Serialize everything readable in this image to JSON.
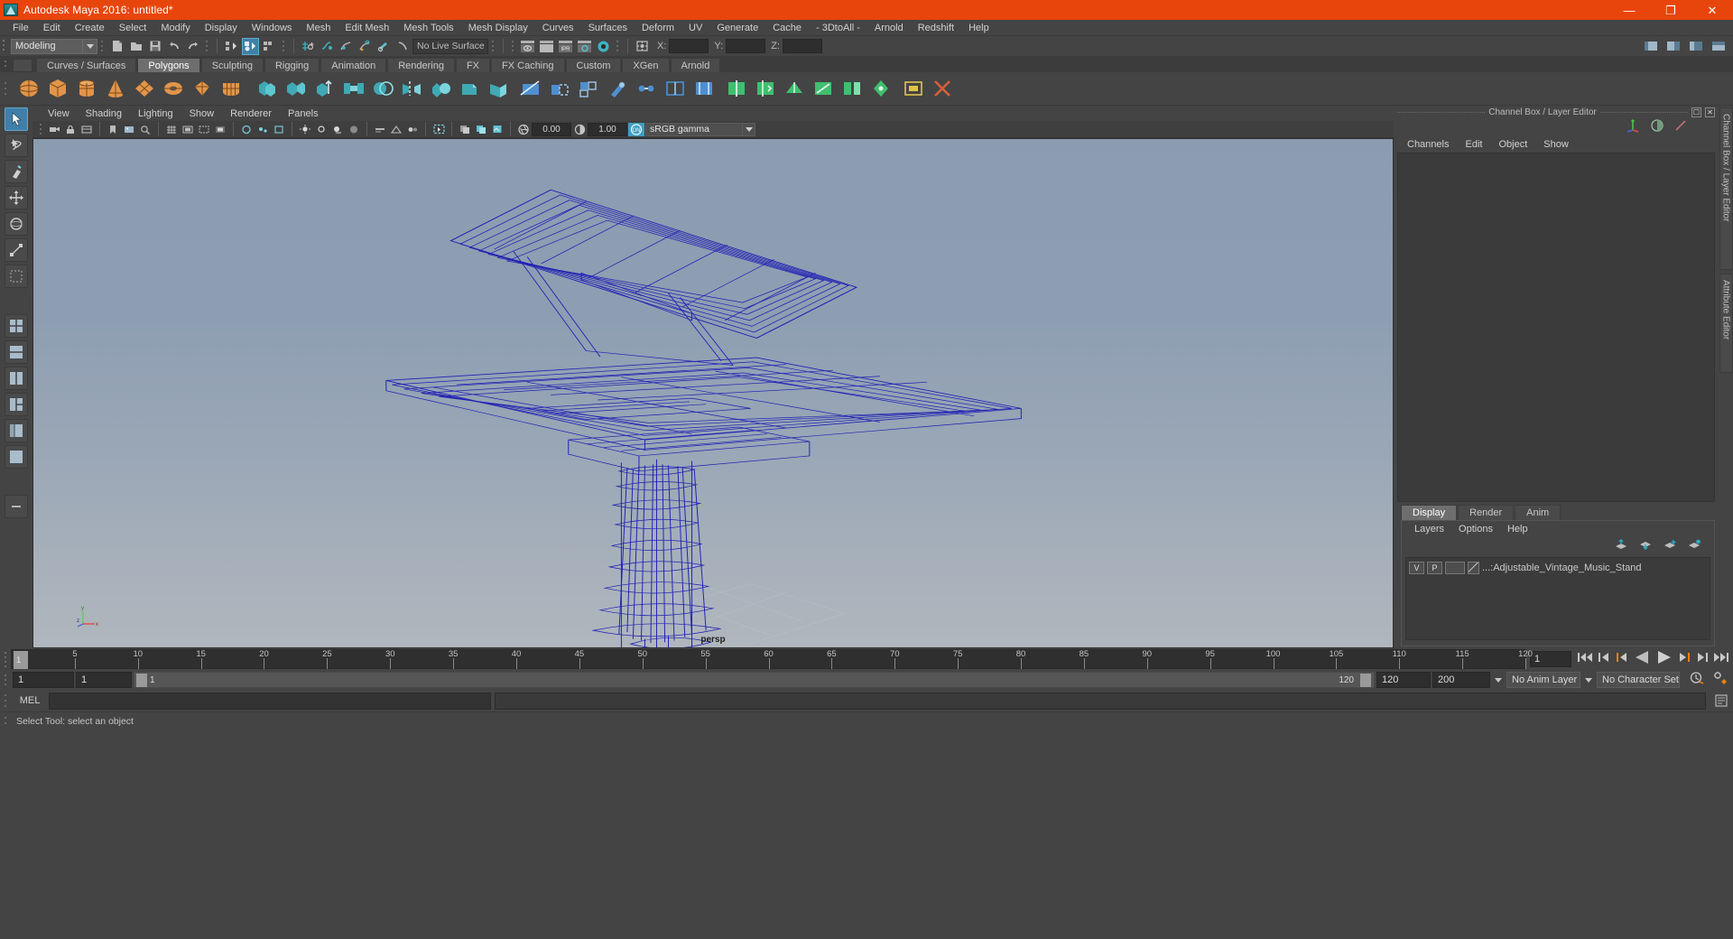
{
  "window": {
    "title": "Autodesk Maya 2016: untitled*",
    "app_icon": "maya-logo-icon",
    "buttons": [
      {
        "name": "minimize-button",
        "glyph": "—"
      },
      {
        "name": "maximize-button",
        "glyph": "❐"
      },
      {
        "name": "close-button",
        "glyph": "✕"
      }
    ],
    "accent_color": "#e8450c",
    "chrome_color": "#444444"
  },
  "menubar": {
    "items": [
      "File",
      "Edit",
      "Create",
      "Select",
      "Modify",
      "Display",
      "Windows",
      "Mesh",
      "Edit Mesh",
      "Mesh Tools",
      "Mesh Display",
      "Curves",
      "Surfaces",
      "Deform",
      "UV",
      "Generate",
      "Cache",
      "- 3DtoAll -",
      "Arnold",
      "Redshift",
      "Help"
    ]
  },
  "statusbar": {
    "menu_set": "Modeling",
    "live_surface": "No Live Surface",
    "coords": {
      "x_label": "X:",
      "y_label": "Y:",
      "z_label": "Z:",
      "x_value": "",
      "y_value": "",
      "z_value": ""
    },
    "icons": [
      "new-scene-icon",
      "open-scene-icon",
      "save-scene-icon",
      "undo-icon",
      "redo-icon",
      "select-by-hierarchy-icon",
      "select-by-object-icon",
      "select-by-component-icon",
      "snap-to-grid-icon",
      "snap-to-curve-icon",
      "snap-to-point-icon",
      "snap-to-projected-center-icon",
      "snap-to-view-plane-icon",
      "make-live-icon",
      "render-view-icon",
      "render-region-icon",
      "ipr-render-icon",
      "render-settings-icon",
      "hypershade-icon",
      "input-selection-icon"
    ],
    "right_icons": [
      "show-hide-editors-icon",
      "sidebar-attribute-icon",
      "sidebar-channel-icon",
      "sidebar-toolsettings-icon"
    ]
  },
  "shelf": {
    "tabs": [
      "Curves / Surfaces",
      "Polygons",
      "Sculpting",
      "Rigging",
      "Animation",
      "Rendering",
      "FX",
      "FX Caching",
      "Custom",
      "XGen",
      "Arnold"
    ],
    "active_tab": "Polygons",
    "icons": [
      {
        "name": "poly-sphere-icon",
        "kind": "sphere",
        "color": "#e2954a"
      },
      {
        "name": "poly-cube-icon",
        "kind": "cube",
        "color": "#e2954a"
      },
      {
        "name": "poly-cylinder-icon",
        "kind": "cylinder",
        "color": "#e2954a"
      },
      {
        "name": "poly-cone-icon",
        "kind": "cone",
        "color": "#e2954a"
      },
      {
        "name": "poly-plane-icon",
        "kind": "plane",
        "color": "#e2954a"
      },
      {
        "name": "poly-torus-icon",
        "kind": "torus",
        "color": "#e2954a"
      },
      {
        "name": "poly-prism-icon",
        "kind": "prism",
        "color": "#e2954a"
      },
      {
        "name": "poly-pyramid-icon",
        "kind": "pyramid",
        "color": "#e2954a"
      },
      {
        "name": "poly-combine-icon",
        "kind": "teal",
        "color": "#3fa9b4"
      },
      {
        "name": "poly-separate-icon",
        "kind": "teal",
        "color": "#3fa9b4"
      },
      {
        "name": "poly-extrude-icon",
        "kind": "teal",
        "color": "#3fa9b4"
      },
      {
        "name": "poly-bridge-icon",
        "kind": "teal",
        "color": "#3fa9b4"
      },
      {
        "name": "poly-booleans-icon",
        "kind": "teal",
        "color": "#3fa9b4"
      },
      {
        "name": "poly-mirror-icon",
        "kind": "teal",
        "color": "#3fa9b4"
      },
      {
        "name": "poly-smooth-icon",
        "kind": "teal",
        "color": "#3fa9b4"
      },
      {
        "name": "poly-bevel-icon",
        "kind": "teal",
        "color": "#3fa9b4"
      },
      {
        "name": "poly-wedge-icon",
        "kind": "teal",
        "color": "#3fa9b4"
      },
      {
        "name": "poly-multicut-icon",
        "kind": "blue",
        "color": "#4f8fd0"
      },
      {
        "name": "poly-append-icon",
        "kind": "blue",
        "color": "#4f8fd0"
      },
      {
        "name": "poly-quad-draw-icon",
        "kind": "blue",
        "color": "#4f8fd0"
      },
      {
        "name": "poly-sculpt-icon",
        "kind": "blue",
        "color": "#4f8fd0"
      },
      {
        "name": "poly-target-weld-icon",
        "kind": "blue",
        "color": "#4f8fd0"
      },
      {
        "name": "poly-connect-icon",
        "kind": "blue",
        "color": "#4f8fd0"
      },
      {
        "name": "poly-offset-edge-icon",
        "kind": "blue",
        "color": "#4f8fd0"
      },
      {
        "name": "poly-insert-edge-loop-icon",
        "kind": "green",
        "color": "#3fbf6f"
      },
      {
        "name": "poly-slide-edge-icon",
        "kind": "green",
        "color": "#3fbf6f"
      },
      {
        "name": "poly-crease-icon",
        "kind": "green",
        "color": "#3fbf6f"
      },
      {
        "name": "poly-spin-edge-icon",
        "kind": "green",
        "color": "#3fbf6f"
      },
      {
        "name": "poly-detach-icon",
        "kind": "green",
        "color": "#3fbf6f"
      },
      {
        "name": "poly-merge-icon",
        "kind": "green",
        "color": "#3fbf6f"
      },
      {
        "name": "poly-chamfer-icon",
        "kind": "yellow",
        "color": "#e0c34a"
      },
      {
        "name": "poly-reduce-icon",
        "kind": "redx",
        "color": "#d4613c"
      }
    ]
  },
  "toolbox": {
    "tools": [
      {
        "name": "select-tool",
        "icon": "arrow-select-icon",
        "selected": true
      },
      {
        "name": "lasso-select-tool",
        "icon": "lasso-icon",
        "selected": false
      },
      {
        "name": "paint-select-tool",
        "icon": "paint-brush-icon",
        "selected": false
      },
      {
        "name": "move-tool",
        "icon": "move-arrows-icon",
        "selected": false
      },
      {
        "name": "rotate-tool",
        "icon": "rotate-ring-icon",
        "selected": false
      },
      {
        "name": "scale-tool",
        "icon": "scale-box-icon",
        "selected": false
      },
      {
        "name": "last-tool",
        "icon": "last-used-tool-icon",
        "selected": false
      },
      {
        "name": "layout-four-view",
        "icon": "four-view-layout-icon",
        "selected": false
      },
      {
        "name": "layout-two-stacked",
        "icon": "two-pane-stacked-icon",
        "selected": false
      },
      {
        "name": "layout-two-side",
        "icon": "two-pane-side-icon",
        "selected": false
      },
      {
        "name": "layout-three-left",
        "icon": "three-pane-left-icon",
        "selected": false
      },
      {
        "name": "layout-persp-outliner",
        "icon": "persp-outliner-icon",
        "selected": false
      },
      {
        "name": "layout-single-persp",
        "icon": "single-persp-icon",
        "selected": false
      },
      {
        "name": "layout-more",
        "icon": "more-layouts-icon",
        "selected": false
      }
    ]
  },
  "viewport": {
    "menus": [
      "View",
      "Shading",
      "Lighting",
      "Show",
      "Renderer",
      "Panels"
    ],
    "camera_label": "persp",
    "exposure": "0.00",
    "gamma": "1.00",
    "color_mgmt": "sRGB gamma",
    "color_mgmt_on": "ON",
    "toolbar_icons": [
      "select-camera-icon",
      "lock-camera-icon",
      "camera-attributes-icon",
      "bookmark-icon",
      "image-plane-icon",
      "two-d-pan-zoom-icon",
      "grid-toggle-icon",
      "film-gate-icon",
      "resolution-gate-icon",
      "gate-mask-icon",
      "film-origin-icon",
      "xray-icon",
      "xray-joints-icon",
      "xray-active-components-icon",
      "default-light-icon",
      "all-lights-icon",
      "shadows-icon",
      "screen-space-ao-icon",
      "motion-blur-icon",
      "multisample-aa-icon",
      "depth-of-field-icon",
      "isolate-select-icon",
      "wireframe-on-shaded-icon",
      "smooth-shade-icon",
      "texture-icon",
      "exposure-icon",
      "contrast-icon",
      "color-management-icon"
    ],
    "gizmo_axes": [
      "y",
      "z",
      "x"
    ],
    "model_name": "Adjustable_Vintage_Music_Stand",
    "wireframe_color": "#1a1ab4",
    "bg_top": "#8b9cb1",
    "bg_bottom": "#b0b6bd"
  },
  "right_panel": {
    "title": "Channel Box / Layer Editor",
    "window_icons": [
      "undock-icon",
      "close-panel-icon"
    ],
    "menus": [
      "Channels",
      "Edit",
      "Object",
      "Show"
    ],
    "header_icons": [
      "transform-channels-icon",
      "shape-channels-icon",
      "output-channels-icon"
    ],
    "layer_tabs": [
      "Display",
      "Render",
      "Anim"
    ],
    "active_layer_tab": "Display",
    "layer_menus": [
      "Layers",
      "Options",
      "Help"
    ],
    "layer_buttons": [
      "move-layer-up-icon",
      "move-layer-down-icon",
      "new-layer-icon",
      "new-layer-from-selected-icon"
    ],
    "layers": [
      {
        "visibility": "V",
        "playback": "P",
        "color_swatch": "",
        "name": "...:Adjustable_Vintage_Music_Stand"
      }
    ],
    "side_tabs": [
      "Channel Box / Layer Editor",
      "Attribute Editor"
    ]
  },
  "timeline": {
    "ticks": [
      5,
      10,
      15,
      20,
      25,
      30,
      35,
      40,
      45,
      50,
      55,
      60,
      65,
      70,
      75,
      80,
      85,
      90,
      95,
      100,
      105,
      110,
      115,
      120
    ],
    "start": 1,
    "end": 120,
    "current_frame": "1",
    "playhead_label": "1",
    "playback_buttons": [
      "go-to-start-icon",
      "step-back-keyframe-icon",
      "step-back-frame-icon",
      "play-backwards-icon",
      "play-forwards-icon",
      "step-forward-frame-icon",
      "step-forward-keyframe-icon",
      "go-to-end-icon"
    ]
  },
  "range": {
    "anim_start": "1",
    "range_start": "1",
    "slider_start_label": "1",
    "slider_end_label": "120",
    "range_end": "120",
    "anim_end": "200",
    "anim_layer": "No Anim Layer",
    "character_set": "No Character Set",
    "right_icons": [
      "auto-keyframe-icon",
      "animation-preferences-icon"
    ]
  },
  "command": {
    "language_label": "MEL",
    "input_value": "",
    "input_placeholder": ""
  },
  "status": {
    "message": "Select Tool: select an object"
  }
}
